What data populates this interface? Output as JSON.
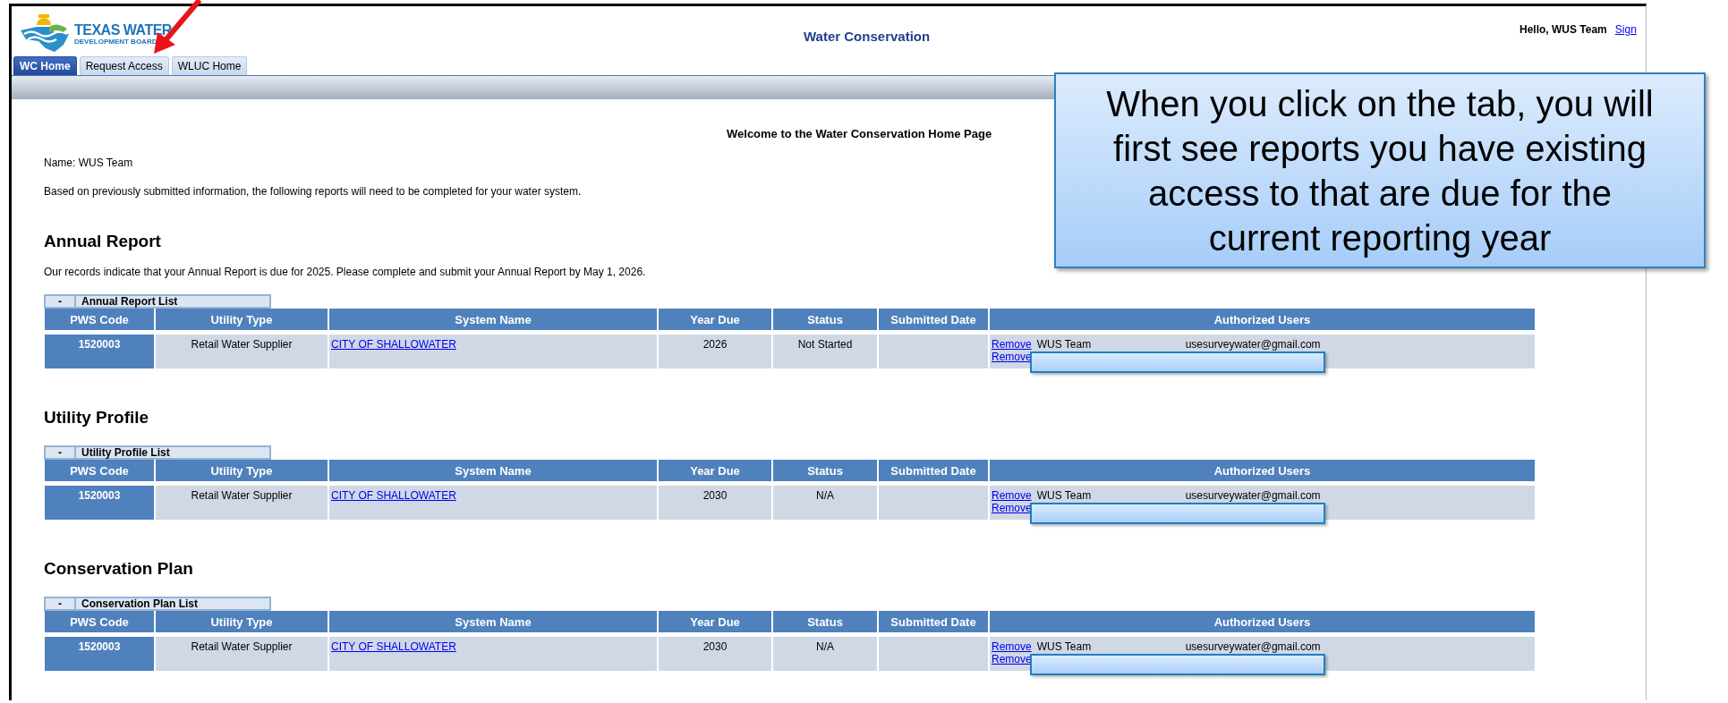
{
  "logo": {
    "line_1": "TEXAS WATER",
    "line_2": "DEVELOPMENT BOARD"
  },
  "header": {
    "title": "Water Conservation",
    "greeting": "Hello, WUS Team",
    "sign_link": "Sign"
  },
  "tabs": [
    {
      "label": "WC Home",
      "selected": true
    },
    {
      "label": "Request Access",
      "selected": false
    },
    {
      "label": "WLUC Home",
      "selected": false
    }
  ],
  "welcome": "Welcome to the Water Conservation Home Page",
  "name_line": "Name: WUS Team",
  "intro": "Based on previously submitted information, the following reports will need to be completed for your water system.",
  "sections": [
    {
      "heading": "Annual Report",
      "note": "Our records indicate that your Annual Report is due for 2025. Please complete and submit your Annual Report by May 1, 2026.",
      "toggle": "-",
      "list_label": "Annual Report List",
      "columns": [
        "PWS Code",
        "Utility Type",
        "System Name",
        "Year Due",
        "Status",
        "Submitted Date",
        "Authorized Users"
      ],
      "rows": [
        {
          "pws_code": "1520003",
          "utility_type": "Retail Water Supplier",
          "system_name": "CITY OF SHALLOWATER",
          "year_due": "2026",
          "status": "Not Started",
          "users": [
            {
              "action": "Remove",
              "name": "WUS Team",
              "email": "usesurveywater@gmail.com"
            },
            {
              "action": "Remove"
            }
          ]
        }
      ]
    },
    {
      "heading": "Utility Profile",
      "toggle": "-",
      "list_label": "Utility Profile List",
      "columns": [
        "PWS Code",
        "Utility Type",
        "System Name",
        "Year Due",
        "Status",
        "Submitted Date",
        "Authorized Users"
      ],
      "rows": [
        {
          "pws_code": "1520003",
          "utility_type": "Retail Water Supplier",
          "system_name": "CITY OF SHALLOWATER",
          "year_due": "2030",
          "status": "N/A",
          "users": [
            {
              "action": "Remove",
              "name": "WUS Team",
              "email": "usesurveywater@gmail.com"
            },
            {
              "action": "Remove"
            }
          ]
        }
      ]
    },
    {
      "heading": "Conservation Plan",
      "toggle": "-",
      "list_label": "Conservation Plan List",
      "columns": [
        "PWS Code",
        "Utility Type",
        "System Name",
        "Year Due",
        "Status",
        "Submitted Date",
        "Authorized Users"
      ],
      "rows": [
        {
          "pws_code": "1520003",
          "utility_type": "Retail Water Supplier",
          "system_name": "CITY OF SHALLOWATER",
          "year_due": "2030",
          "status": "N/A",
          "users": [
            {
              "action": "Remove",
              "name": "WUS Team",
              "email": "usesurveywater@gmail.com"
            },
            {
              "action": "Remove"
            }
          ]
        }
      ]
    }
  ],
  "callout": "When you click on the tab, you will first see reports you have existing access to that are due for the current reporting year"
}
